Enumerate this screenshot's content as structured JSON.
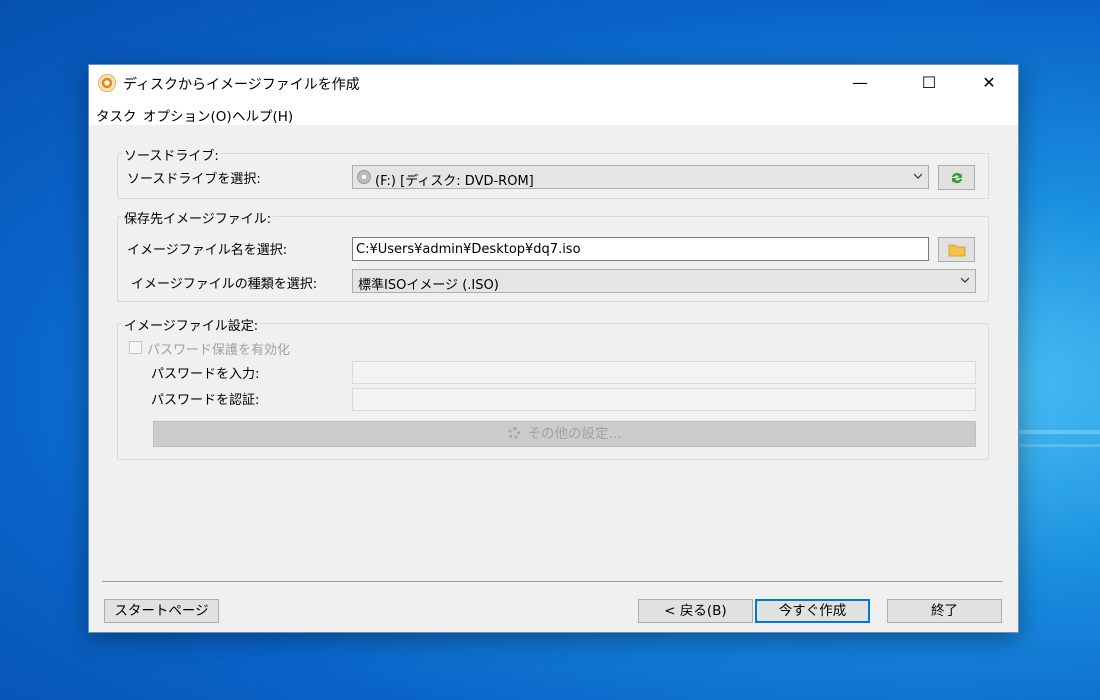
{
  "window": {
    "title": "ディスクからイメージファイルを作成",
    "controls": {
      "minimize": "—",
      "maximize": "☐",
      "close": "✕"
    }
  },
  "menu": {
    "items": [
      "タスク",
      "オプション(O)",
      "ヘルプ(H)"
    ]
  },
  "source_drive": {
    "group_title": "ソースドライブ:",
    "label": "ソースドライブを選択:",
    "selected": "(F:) [ディスク: DVD-ROM]"
  },
  "destination": {
    "group_title": "保存先イメージファイル:",
    "name_label": "イメージファイル名を選択:",
    "path": "C:¥Users¥admin¥Desktop¥dq7.iso",
    "type_label": "イメージファイルの種類を選択:",
    "type_value": "標準ISOイメージ (.ISO)"
  },
  "settings": {
    "group_title": "イメージファイル設定:",
    "password_checkbox": "パスワード保護を有効化",
    "password_checked": false,
    "password_label": "パスワードを入力:",
    "confirm_label": "パスワードを認証:",
    "more_settings": "その他の設定..."
  },
  "footer": {
    "start_page": "スタートページ",
    "back": "< 戻る(B)",
    "create_now": "今すぐ作成",
    "finish": "終了"
  },
  "colors": {
    "accent": "#0078d7",
    "desktop": "#0a64c8"
  }
}
